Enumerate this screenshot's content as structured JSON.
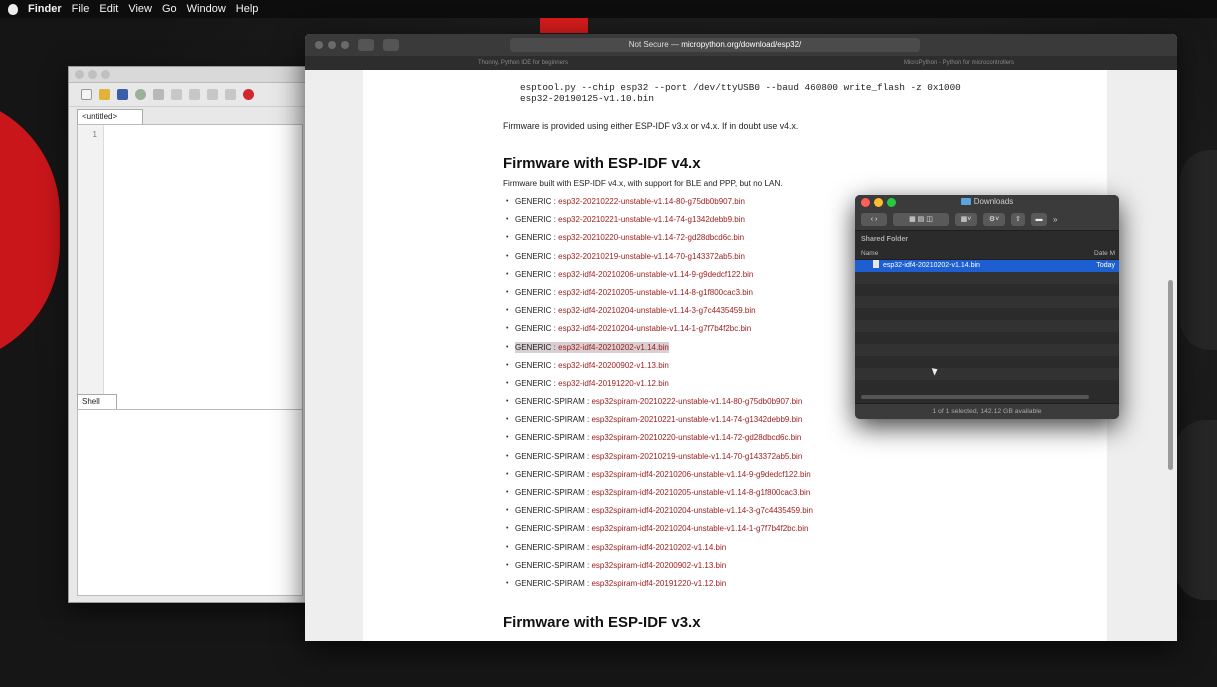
{
  "menubar": {
    "app": "Finder",
    "items": [
      "File",
      "Edit",
      "View",
      "Go",
      "Window",
      "Help"
    ]
  },
  "thonny": {
    "editor_tab": "<untitled>",
    "line_number": "1",
    "shell_tab": "Shell"
  },
  "safari": {
    "url_prefix": "Not Secure —",
    "url_host": "micropython.org/download/esp32/",
    "tabs": [
      "Thonny, Python IDE for beginners",
      "MicroPython - Python for microcontrollers"
    ],
    "page": {
      "command_line1": "esptool.py --chip esp32 --port /dev/ttyUSB0 --baud 460800 write_flash -z 0x1000",
      "command_line2": "esp32-20190125-v1.10.bin",
      "note": "Firmware is provided using either ESP-IDF v3.x or v4.x. If in doubt use v4.x.",
      "heading_v4": "Firmware with ESP-IDF v4.x",
      "subtitle_v4": "Firmware built with ESP-IDF v4.x, with support for BLE and PPP, but no LAN.",
      "firmware": [
        {
          "kind": "GENERIC : ",
          "file": "esp32-20210222-unstable-v1.14-80-g75db0b907.bin"
        },
        {
          "kind": "GENERIC : ",
          "file": "esp32-20210221-unstable-v1.14-74-g1342debb9.bin"
        },
        {
          "kind": "GENERIC : ",
          "file": "esp32-20210220-unstable-v1.14-72-gd28dbcd6c.bin"
        },
        {
          "kind": "GENERIC : ",
          "file": "esp32-20210219-unstable-v1.14-70-g143372ab5.bin"
        },
        {
          "kind": "GENERIC : ",
          "file": "esp32-idf4-20210206-unstable-v1.14-9-g9dedcf122.bin"
        },
        {
          "kind": "GENERIC : ",
          "file": "esp32-idf4-20210205-unstable-v1.14-8-g1f800cac3.bin"
        },
        {
          "kind": "GENERIC : ",
          "file": "esp32-idf4-20210204-unstable-v1.14-3-g7c4435459.bin"
        },
        {
          "kind": "GENERIC : ",
          "file": "esp32-idf4-20210204-unstable-v1.14-1-g7f7b4f2bc.bin"
        },
        {
          "kind": "GENERIC : ",
          "file": "esp32-idf4-20210202-v1.14.bin"
        },
        {
          "kind": "GENERIC : ",
          "file": "esp32-idf4-20200902-v1.13.bin"
        },
        {
          "kind": "GENERIC : ",
          "file": "esp32-idf4-20191220-v1.12.bin"
        },
        {
          "kind": "GENERIC-SPIRAM : ",
          "file": "esp32spiram-20210222-unstable-v1.14-80-g75db0b907.bin"
        },
        {
          "kind": "GENERIC-SPIRAM : ",
          "file": "esp32spiram-20210221-unstable-v1.14-74-g1342debb9.bin"
        },
        {
          "kind": "GENERIC-SPIRAM : ",
          "file": "esp32spiram-20210220-unstable-v1.14-72-gd28dbcd6c.bin"
        },
        {
          "kind": "GENERIC-SPIRAM : ",
          "file": "esp32spiram-20210219-unstable-v1.14-70-g143372ab5.bin"
        },
        {
          "kind": "GENERIC-SPIRAM : ",
          "file": "esp32spiram-idf4-20210206-unstable-v1.14-9-g9dedcf122.bin"
        },
        {
          "kind": "GENERIC-SPIRAM : ",
          "file": "esp32spiram-idf4-20210205-unstable-v1.14-8-g1f800cac3.bin"
        },
        {
          "kind": "GENERIC-SPIRAM : ",
          "file": "esp32spiram-idf4-20210204-unstable-v1.14-3-g7c4435459.bin"
        },
        {
          "kind": "GENERIC-SPIRAM : ",
          "file": "esp32spiram-idf4-20210204-unstable-v1.14-1-g7f7b4f2bc.bin"
        },
        {
          "kind": "GENERIC-SPIRAM : ",
          "file": "esp32spiram-idf4-20210202-v1.14.bin"
        },
        {
          "kind": "GENERIC-SPIRAM : ",
          "file": "esp32spiram-idf4-20200902-v1.13.bin"
        },
        {
          "kind": "GENERIC-SPIRAM : ",
          "file": "esp32spiram-idf4-20191220-v1.12.bin"
        }
      ],
      "highlighted_index": 8,
      "heading_v3": "Firmware with ESP-IDF v3.x"
    }
  },
  "finder": {
    "title": "Downloads",
    "section": "Shared Folder",
    "col_name": "Name",
    "col_date": "Date M",
    "file_name": "esp32-idf4-20210202-v1.14.bin",
    "file_date": "Today",
    "status": "1 of 1 selected, 142.12 GB available"
  },
  "colors": {
    "link": "#9e1b1b",
    "selection": "#1d5fd1",
    "accent_red": "#d91c1c"
  }
}
